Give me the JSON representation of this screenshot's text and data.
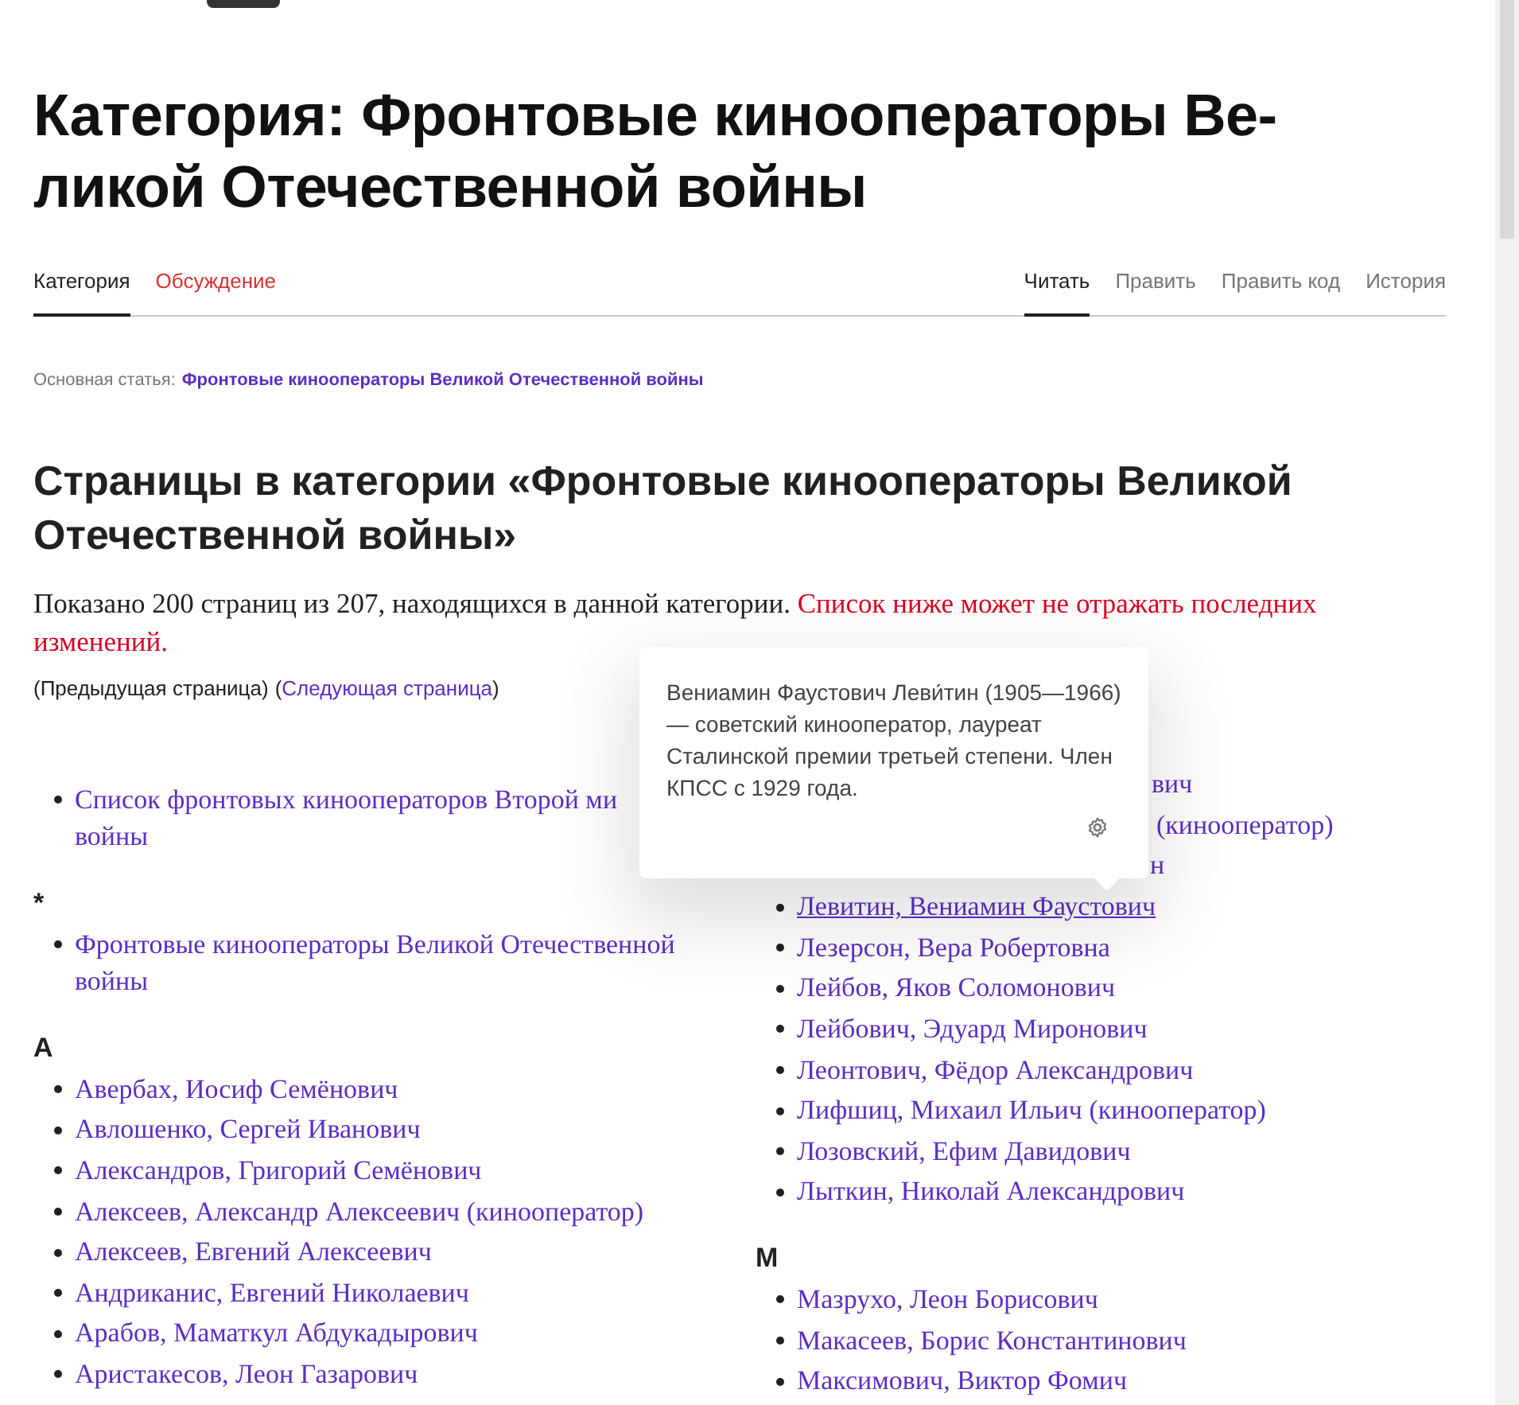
{
  "title": "Категория: Фронтовые кинооператоры Ве-\nликой Отечественной войны",
  "tabs_left": [
    {
      "label": "Категория",
      "selected": true,
      "missing": false
    },
    {
      "label": "Обсуждение",
      "selected": false,
      "missing": true
    }
  ],
  "tabs_right": [
    {
      "label": "Читать",
      "selected": true
    },
    {
      "label": "Править",
      "selected": false
    },
    {
      "label": "Править код",
      "selected": false
    },
    {
      "label": "История",
      "selected": false
    }
  ],
  "main_article": {
    "label": "Основная статья:",
    "link": "Фронтовые кинооператоры Великой Отечественной войны"
  },
  "heading": "Страницы в категории «Фронтовые кинооператоры Великой Отечественной войны»",
  "count_text": "Показано 200 страниц из 207, находящихся в данной категории.",
  "warning_text": "Список ниже может не отражать последних изменений.",
  "pager": {
    "prev": "(Предыдущая страница)",
    "next_open": "(",
    "next": "Следующая страница",
    "next_close": ")"
  },
  "left_column": [
    {
      "kind": "items",
      "items": [
        {
          "text": "Список фронтовых кинооператоров Второй ми\nвойны",
          "hovered": false
        }
      ]
    },
    {
      "kind": "group",
      "letter": "*",
      "items": [
        {
          "text": "Фронтовые кинооператоры Великой Отечественной войны",
          "hovered": false
        }
      ]
    },
    {
      "kind": "group",
      "letter": "А",
      "items": [
        {
          "text": "Авербах, Иосиф Семёнович",
          "hovered": false
        },
        {
          "text": "Авлошенко, Сергей Иванович",
          "hovered": false
        },
        {
          "text": "Александров, Григорий Семёнович",
          "hovered": false
        },
        {
          "text": "Алексеев, Александр Алексеевич (кинооператор)",
          "hovered": false
        },
        {
          "text": "Алексеев, Евгений Алексеевич",
          "hovered": false
        },
        {
          "text": "Андриканис, Евгений Николаевич",
          "hovered": false
        },
        {
          "text": "Арабов, Маматкул Абдукадырович",
          "hovered": false
        },
        {
          "text": "Аристакесов, Леон Газарович",
          "hovered": false
        }
      ]
    }
  ],
  "right_column": [
    {
      "kind": "partial",
      "fragments": [
        "вич",
        "(кинооператор)",
        "н"
      ]
    },
    {
      "kind": "items",
      "items": [
        {
          "text": "Левитин, Вениамин Фаустович",
          "hovered": true
        },
        {
          "text": "Лезерсон, Вера Робертовна",
          "hovered": false
        },
        {
          "text": "Лейбов, Яков Соломонович",
          "hovered": false
        },
        {
          "text": "Лейбович, Эдуард Миронович",
          "hovered": false
        },
        {
          "text": "Леонтович, Фёдор Александрович",
          "hovered": false
        },
        {
          "text": "Лифшиц, Михаил Ильич (кинооператор)",
          "hovered": false
        },
        {
          "text": "Лозовский, Ефим Давидович",
          "hovered": false
        },
        {
          "text": "Лыткин, Николай Александрович",
          "hovered": false
        }
      ]
    },
    {
      "kind": "group",
      "letter": "М",
      "items": [
        {
          "text": "Мазрухо, Леон Борисович",
          "hovered": false
        },
        {
          "text": "Макасеев, Борис Константинович",
          "hovered": false
        },
        {
          "text": "Максимович, Виктор Фомич",
          "hovered": false
        }
      ]
    }
  ],
  "popup": {
    "text": "Вениамин Фаустович Леви́тин (1905—1966) — советский кинооператор, лауреат Сталинской премии третьей степени. Член КПСС с 1929 года."
  }
}
